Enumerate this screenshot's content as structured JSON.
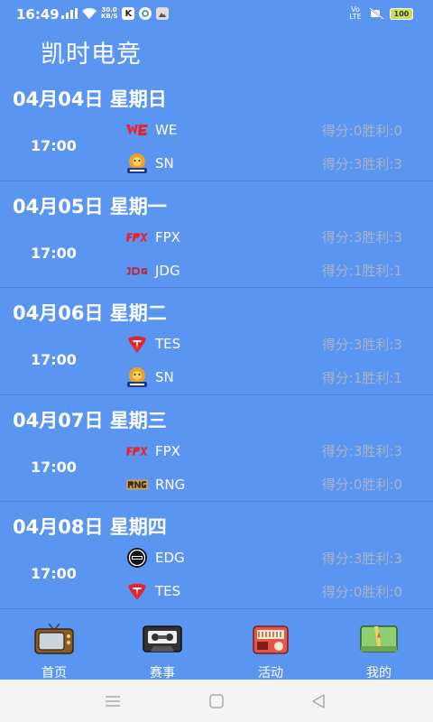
{
  "status_bar": {
    "time": "16:49",
    "net_speed_value": "30.0",
    "net_speed_unit": "KB/S",
    "app_badge": "K",
    "volte": "Vo LTE",
    "battery": "100"
  },
  "app": {
    "title": "凯时电竞"
  },
  "days": [
    {
      "date": "04月04日  星期日",
      "time": "17:00",
      "teams": [
        {
          "name": "WE",
          "score": "得分:0胜利:0",
          "logo": "we-logo"
        },
        {
          "name": "SN",
          "score": "得分:3胜利:3",
          "logo": "sn-logo"
        }
      ]
    },
    {
      "date": "04月05日  星期一",
      "time": "17:00",
      "teams": [
        {
          "name": "FPX",
          "score": "得分:3胜利:3",
          "logo": "fpx-logo"
        },
        {
          "name": "JDG",
          "score": "得分:1胜利:1",
          "logo": "jdg-logo"
        }
      ]
    },
    {
      "date": "04月06日  星期二",
      "time": "17:00",
      "teams": [
        {
          "name": "TES",
          "score": "得分:3胜利:3",
          "logo": "tes-logo"
        },
        {
          "name": "SN",
          "score": "得分:1胜利:1",
          "logo": "sn-logo"
        }
      ]
    },
    {
      "date": "04月07日  星期三",
      "time": "17:00",
      "teams": [
        {
          "name": "FPX",
          "score": "得分:3胜利:3",
          "logo": "fpx-logo"
        },
        {
          "name": "RNG",
          "score": "得分:0胜利:0",
          "logo": "rng-logo"
        }
      ]
    },
    {
      "date": "04月08日  星期四",
      "time": "17:00",
      "teams": [
        {
          "name": "EDG",
          "score": "得分:3胜利:3",
          "logo": "edg-logo"
        },
        {
          "name": "TES",
          "score": "得分:0胜利:0",
          "logo": "tes-logo"
        }
      ]
    }
  ],
  "bottom_nav": [
    {
      "label": "首页",
      "icon": "tv-icon"
    },
    {
      "label": "赛事",
      "icon": "cassette-icon"
    },
    {
      "label": "活动",
      "icon": "radio-icon"
    },
    {
      "label": "我的",
      "icon": "map-icon"
    }
  ],
  "colors": {
    "background": "#5b95f2",
    "score_text": "#aab3c7",
    "battery": "#cde052"
  }
}
